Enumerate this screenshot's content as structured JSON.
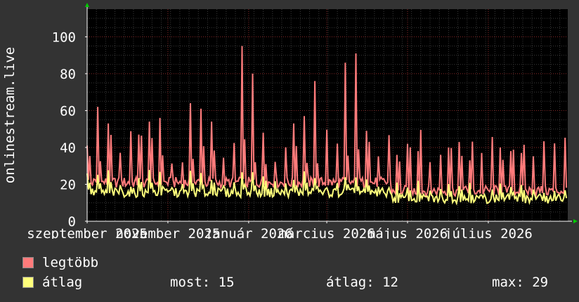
{
  "chart_data": {
    "type": "line",
    "title": "",
    "ylabel": "onlinestream.live",
    "ylim": [
      0,
      115
    ],
    "yticks": [
      0,
      20,
      40,
      60,
      80,
      100
    ],
    "xticks": [
      {
        "label": "szeptember 2025",
        "day": 0
      },
      {
        "label": "november 2025",
        "day": 61
      },
      {
        "label": "január 2026",
        "day": 122
      },
      {
        "label": "március 2026",
        "day": 181
      },
      {
        "label": "május 2026",
        "day": 242
      },
      {
        "label": "július 2026",
        "day": 303
      }
    ],
    "x_start": "2025-09-01",
    "x_end": "2026-08-30",
    "grid": true,
    "series": [
      {
        "name": "legtöbb",
        "color": "#ff7b7b",
        "role": "max"
      },
      {
        "name": "átlag",
        "color": "#ffff7b",
        "role": "average"
      }
    ],
    "peaks_legtobb": [
      41,
      62,
      53,
      86,
      48,
      47,
      54,
      56,
      48,
      56,
      64,
      61,
      54,
      75,
      103,
      95,
      80,
      48,
      51,
      71,
      53,
      57,
      76,
      55,
      57,
      86,
      91,
      49,
      44,
      40,
      36,
      42,
      38,
      40,
      37,
      40,
      43,
      33,
      45,
      42,
      40,
      38,
      37,
      40
    ]
  },
  "legend": {
    "items": [
      {
        "label": "legtöbb",
        "color": "#ff7b7b"
      },
      {
        "label": "átlag",
        "color": "#ffff7b"
      }
    ],
    "stats": {
      "most": "most: 15",
      "atlag": "átlag: 12",
      "max": "max: 29"
    }
  }
}
